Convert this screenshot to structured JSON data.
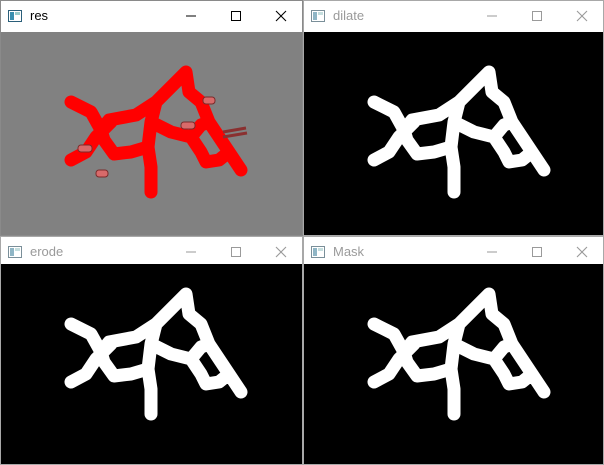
{
  "windows": [
    {
      "key": "res",
      "title": "res",
      "active": true,
      "content": "molecule-red-on-gray",
      "controls": {
        "minimize": "minimize-icon",
        "maximize": "maximize-icon",
        "close": "close-icon"
      }
    },
    {
      "key": "dilate",
      "title": "dilate",
      "active": false,
      "content": "mask-white-on-black-thick"
    },
    {
      "key": "erode",
      "title": "erode",
      "active": false,
      "content": "mask-white-on-black-thin"
    },
    {
      "key": "mask",
      "title": "Mask",
      "active": false,
      "content": "mask-white-on-black"
    }
  ],
  "colors": {
    "title_active": "#000000",
    "title_inactive": "#9a9a9a",
    "res_background": "#818181",
    "molecule_red": "#ff0000",
    "mask_background": "#000000",
    "mask_foreground": "#ffffff"
  }
}
